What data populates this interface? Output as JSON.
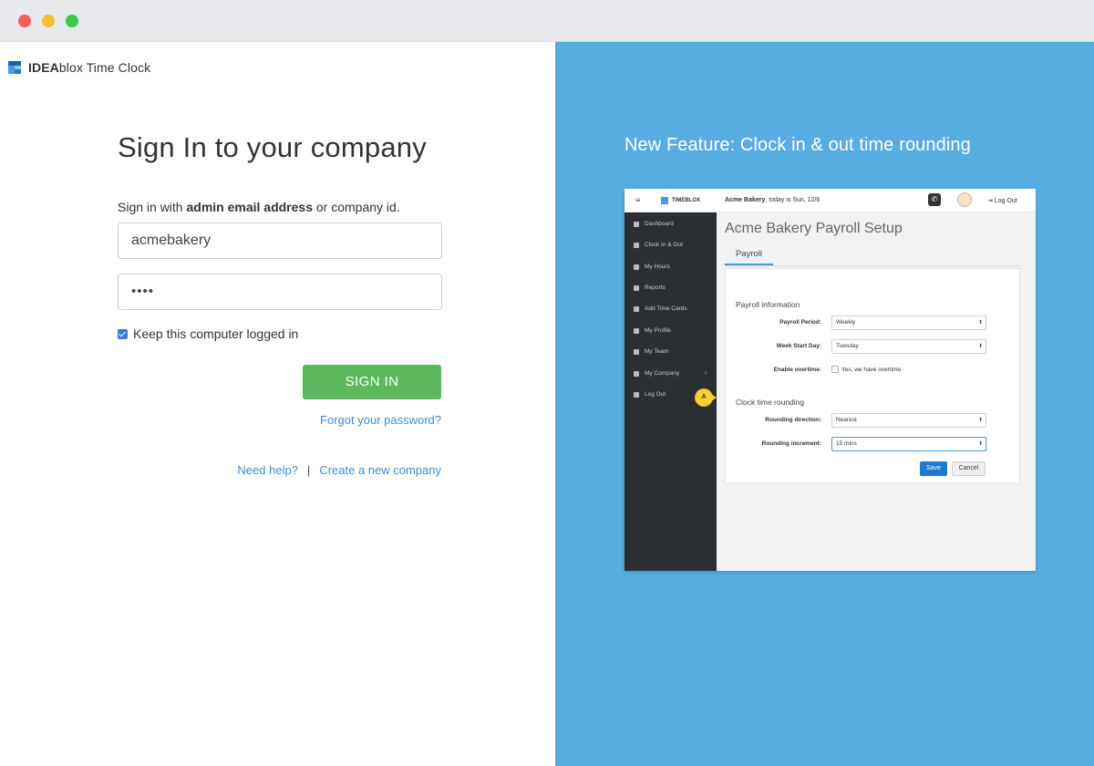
{
  "window": {
    "controls": [
      "close",
      "minimize",
      "maximize"
    ]
  },
  "brand": {
    "bold": "IDEA",
    "rest": "blox Time Clock",
    "colors": [
      "#1e5fa8",
      "#4a9ad8",
      "#8fc4ec"
    ]
  },
  "login": {
    "title": "Sign In to your company",
    "hint_prefix": "Sign in with ",
    "hint_bold": "admin email address",
    "hint_suffix": " or company id.",
    "username_value": "acmebakery",
    "password_value": "••••",
    "keep_logged_in_label": "Keep this computer logged in",
    "keep_logged_in_checked": true,
    "signin_label": "SIGN IN",
    "forgot_label": "Forgot your password?",
    "help_label": "Need help?",
    "separator": "|",
    "create_label": "Create a new company"
  },
  "promo": {
    "title": "New Feature: Clock in & out time rounding",
    "background": "#57ade2",
    "screenshot": {
      "menu_icon": "⋅≡",
      "brand": "TIMEBLOX",
      "company_bold": "Acme Bakery",
      "company_rest": ", today is Sun, 12/6",
      "phone_icon": "✆",
      "logout": "⇥ Log Out",
      "sidebar": [
        {
          "label": "Dashboard"
        },
        {
          "label": "Clock In & Out"
        },
        {
          "label": "My Hours"
        },
        {
          "label": "Reports"
        },
        {
          "label": "Add Time Cards"
        },
        {
          "label": "My Profile"
        },
        {
          "label": "My Team"
        },
        {
          "label": "My Company",
          "chevron": "›"
        },
        {
          "label": "Log Out"
        }
      ],
      "page_title": "Acme Bakery Payroll Setup",
      "tab": "Payroll",
      "section_payroll": "Payroll information",
      "payroll_period_label": "Payroll Period:",
      "payroll_period_value": "Weekly",
      "week_start_label": "Week Start Day:",
      "week_start_value": "Tuesday",
      "overtime_label": "Enable overtime:",
      "overtime_text": "Yes, we have overtime.",
      "section_rounding": "Clock time rounding",
      "rounding_direction_label": "Rounding direction:",
      "rounding_direction_value": "Nearest",
      "rounding_increment_label": "Rounding increment:",
      "rounding_increment_value": "15 mins",
      "select_arrow": "⬍",
      "save_label": "Save",
      "cancel_label": "Cancel",
      "callout_letter": "A"
    }
  }
}
